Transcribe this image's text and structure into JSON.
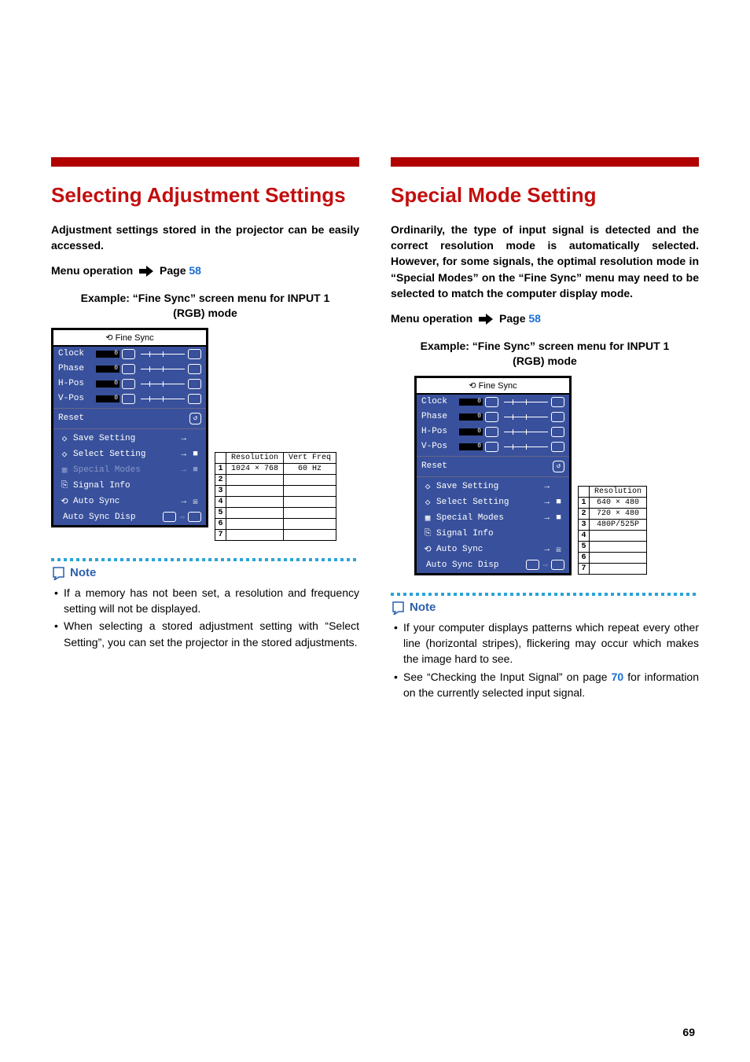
{
  "page_number": "69",
  "left": {
    "heading": "Selecting Adjustment Settings",
    "intro": "Adjustment settings stored in the projector can be easily accessed.",
    "menu_op_prefix": "Menu operation",
    "menu_op_page_label": "Page",
    "menu_op_page_num": "58",
    "example_caption": "Example: “Fine Sync” screen menu for INPUT 1 (RGB) mode",
    "osd": {
      "title": "Fine Sync",
      "sliders": [
        "Clock",
        "Phase",
        "H-Pos",
        "V-Pos"
      ],
      "reset": "Reset",
      "items": [
        {
          "label": "Save Setting",
          "muted": false,
          "end": ""
        },
        {
          "label": "Select Setting",
          "muted": false,
          "end": "■"
        },
        {
          "label": "Special Modes",
          "muted": true,
          "end": "■"
        },
        {
          "label": "Signal Info",
          "muted": false,
          "end": ""
        },
        {
          "label": "Auto Sync",
          "muted": false,
          "end": "☒"
        }
      ],
      "bottom_label": "Auto Sync Disp"
    },
    "side_table": {
      "headers": [
        "Resolution",
        "Vert Freq"
      ],
      "rows": [
        {
          "idx": "1",
          "resolution": "1024 ×  768",
          "vfreq": "60 Hz"
        },
        {
          "idx": "2",
          "resolution": "",
          "vfreq": ""
        },
        {
          "idx": "3",
          "resolution": "",
          "vfreq": ""
        },
        {
          "idx": "4",
          "resolution": "",
          "vfreq": ""
        },
        {
          "idx": "5",
          "resolution": "",
          "vfreq": ""
        },
        {
          "idx": "6",
          "resolution": "",
          "vfreq": ""
        },
        {
          "idx": "7",
          "resolution": "",
          "vfreq": ""
        }
      ]
    },
    "note_label": "Note",
    "notes": [
      "If a memory has not been set, a resolution and frequency setting will not be displayed.",
      "When selecting a stored adjustment setting with “Select Setting”, you can set the projector in the stored adjustments."
    ]
  },
  "right": {
    "heading": "Special Mode Setting",
    "intro": "Ordinarily, the type of input signal is detected and the correct resolution mode is automatically selected. However, for some signals, the optimal resolution mode in “Special Modes” on the “Fine Sync” menu may need to be selected to match the computer display mode.",
    "menu_op_prefix": "Menu operation",
    "menu_op_page_label": "Page",
    "menu_op_page_num": "58",
    "example_caption": "Example: “Fine Sync” screen menu for INPUT 1 (RGB) mode",
    "osd": {
      "title": "Fine Sync",
      "sliders": [
        "Clock",
        "Phase",
        "H-Pos",
        "V-Pos"
      ],
      "reset": "Reset",
      "items": [
        {
          "label": "Save Setting",
          "muted": false,
          "end": ""
        },
        {
          "label": "Select Setting",
          "muted": false,
          "end": "■"
        },
        {
          "label": "Special Modes",
          "muted": false,
          "end": "■"
        },
        {
          "label": "Signal Info",
          "muted": false,
          "end": ""
        },
        {
          "label": "Auto Sync",
          "muted": false,
          "end": "☒"
        }
      ],
      "bottom_label": "Auto Sync Disp"
    },
    "side_table": {
      "headers": [
        "Resolution"
      ],
      "rows": [
        {
          "idx": "1",
          "resolution": "640 × 480"
        },
        {
          "idx": "2",
          "resolution": "720 × 480"
        },
        {
          "idx": "3",
          "resolution": "480P/525P"
        },
        {
          "idx": "4",
          "resolution": ""
        },
        {
          "idx": "5",
          "resolution": ""
        },
        {
          "idx": "6",
          "resolution": ""
        },
        {
          "idx": "7",
          "resolution": ""
        }
      ]
    },
    "note_label": "Note",
    "note_1_text": "If your computer displays patterns which repeat every other line (horizontal stripes), flickering may occur which makes the image hard to see.",
    "note_2_prefix": "See “Checking the Input Signal” on page ",
    "note_2_page": "70",
    "note_2_suffix": " for information on the currently selected input signal."
  }
}
